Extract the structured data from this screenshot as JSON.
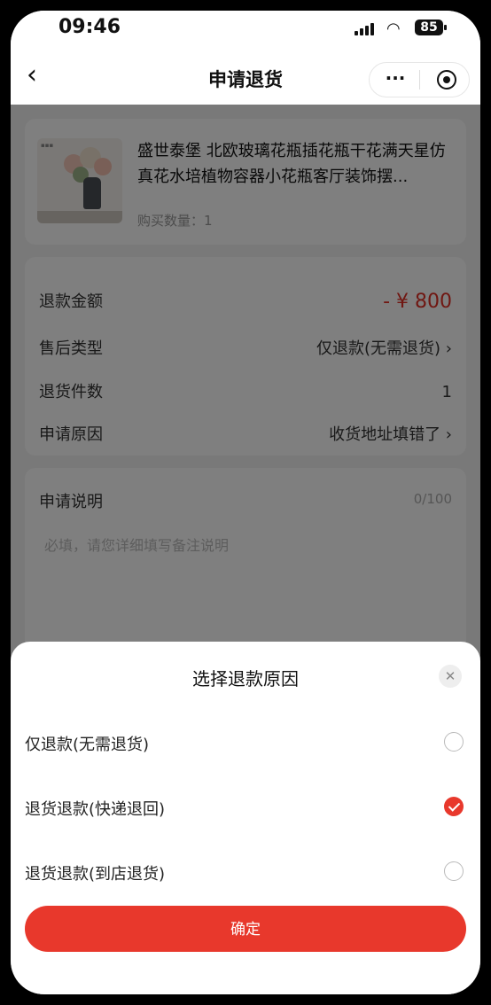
{
  "status_bar": {
    "time": "09:46",
    "battery": "85"
  },
  "nav": {
    "title": "申请退货",
    "more_icon": "···"
  },
  "product": {
    "name": "盛世泰堡 北欧玻璃花瓶插花瓶干花满天星仿真花水培植物容器小花瓶客厅装饰摆...",
    "quantity": "购买数量：1"
  },
  "details": [
    {
      "label": "退款金额",
      "value": "- ¥ 800"
    },
    {
      "label": "售后类型",
      "value": "仅退款(无需退货) ›"
    },
    {
      "label": "退货件数",
      "value": "1"
    },
    {
      "label": "申请原因",
      "value": "收货地址填错了 ›"
    }
  ],
  "note": {
    "label": "申请说明",
    "count": "0/100",
    "placeholder": "必填，请您详细填写备注说明"
  },
  "sheet": {
    "title": "选择退款原因",
    "options": [
      {
        "label": "仅退款(无需退货)",
        "selected": false
      },
      {
        "label": "退货退款(快递退回)",
        "selected": true
      },
      {
        "label": "退货退款(到店退货)",
        "selected": false
      }
    ],
    "confirm": "确定"
  },
  "colors": {
    "accent": "#e8382c",
    "price": "#e02e24"
  }
}
